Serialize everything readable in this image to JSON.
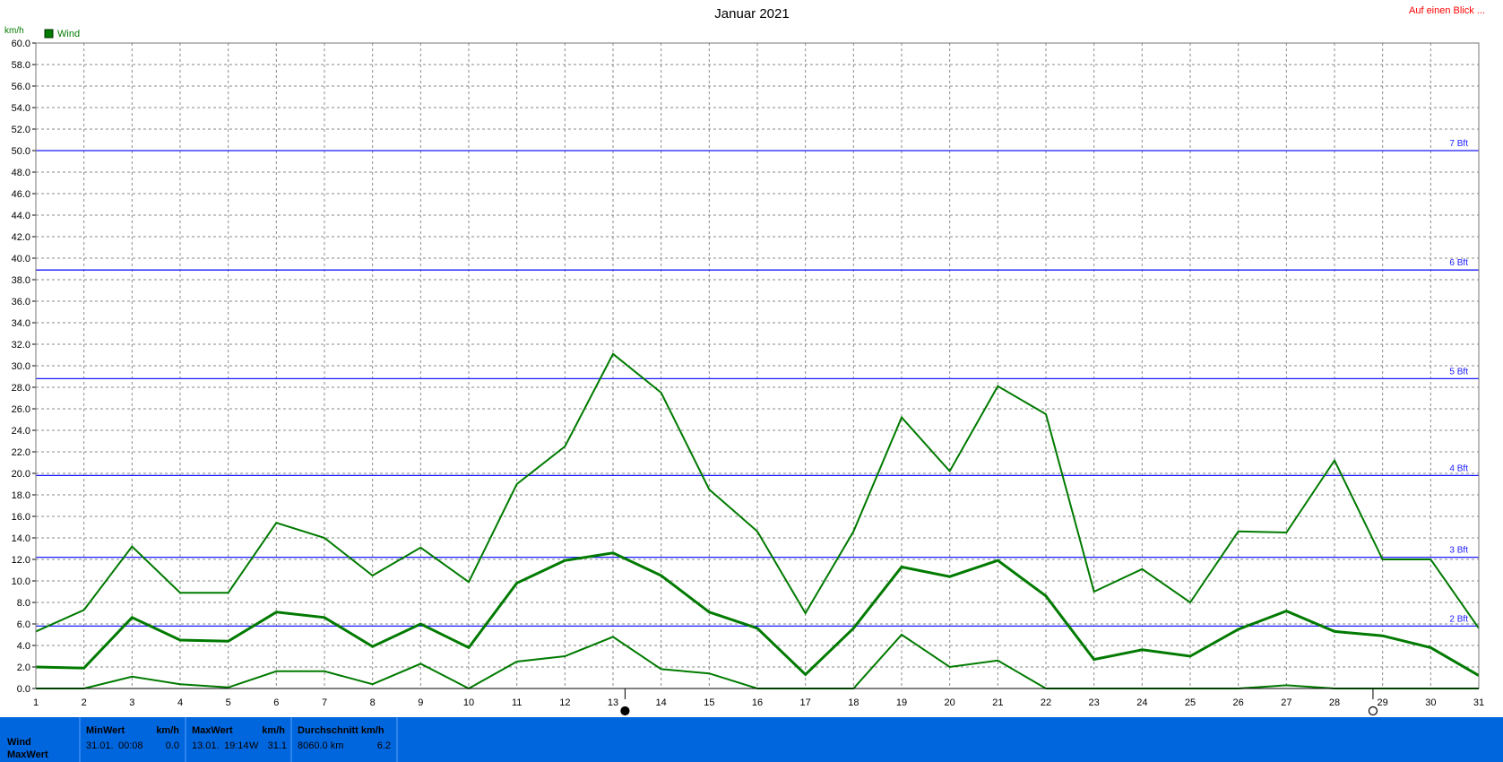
{
  "header": {
    "title": "Januar 2021",
    "top_link": "Auf einen Blick ...",
    "y_unit": "km/h",
    "legend_label": "Wind"
  },
  "colors": {
    "series": "#007a00",
    "beaufort": "#1a1aff",
    "grid": "#8a8a8a",
    "footer_bg": "#0066dd",
    "link": "#ff0000"
  },
  "chart_data": {
    "type": "line",
    "title": "Januar 2021",
    "ylabel": "km/h",
    "xlabel": "",
    "x": [
      1,
      2,
      3,
      4,
      5,
      6,
      7,
      8,
      9,
      10,
      11,
      12,
      13,
      14,
      15,
      16,
      17,
      18,
      19,
      20,
      21,
      22,
      23,
      24,
      25,
      26,
      27,
      28,
      29,
      30,
      31
    ],
    "ylim": [
      0,
      60
    ],
    "xlim": [
      1,
      31
    ],
    "y_tick_step": 2,
    "grid": true,
    "legend": [
      {
        "label": "Wind",
        "position": "top-left"
      }
    ],
    "series": [
      {
        "name": "Wind",
        "role": "max",
        "width": 2,
        "values": [
          5.3,
          7.3,
          13.2,
          8.9,
          8.9,
          15.4,
          14.0,
          10.5,
          13.1,
          9.9,
          19.0,
          22.5,
          31.1,
          27.5,
          18.5,
          14.6,
          7.0,
          14.6,
          25.2,
          20.2,
          28.1,
          25.5,
          9.0,
          11.1,
          8.0,
          14.6,
          14.5,
          21.2,
          12.0,
          12.0,
          5.6
        ]
      },
      {
        "name": "Wind",
        "role": "average",
        "width": 3,
        "values": [
          2.0,
          1.9,
          6.6,
          4.5,
          4.4,
          7.1,
          6.6,
          3.9,
          6.0,
          3.8,
          9.8,
          11.9,
          12.6,
          10.5,
          7.1,
          5.6,
          1.3,
          5.6,
          11.3,
          10.4,
          11.9,
          8.6,
          2.7,
          3.6,
          3.0,
          5.5,
          7.2,
          5.3,
          4.9,
          3.8,
          1.2
        ]
      },
      {
        "name": "Wind",
        "role": "min",
        "width": 2,
        "values": [
          0.0,
          0.0,
          1.1,
          0.4,
          0.1,
          1.6,
          1.6,
          0.4,
          2.3,
          0.0,
          2.5,
          3.0,
          4.8,
          1.8,
          1.4,
          0.0,
          0.0,
          0.0,
          5.0,
          2.0,
          2.6,
          0.0,
          0.0,
          0.0,
          0.0,
          0.0,
          0.3,
          0.0,
          0.0,
          0.0,
          0.0
        ]
      }
    ],
    "reference_lines": [
      {
        "label": "2 Bft",
        "value": 5.8
      },
      {
        "label": "3 Bft",
        "value": 12.2
      },
      {
        "label": "4 Bft",
        "value": 19.8
      },
      {
        "label": "5 Bft",
        "value": 28.8
      },
      {
        "label": "6 Bft",
        "value": 38.9
      },
      {
        "label": "7 Bft",
        "value": 50.0
      }
    ],
    "moon_phases": [
      {
        "day": 13.25,
        "phase": "new-moon"
      },
      {
        "day": 28.8,
        "phase": "full-moon"
      }
    ]
  },
  "footer": {
    "row_labels": [
      "Wind",
      "MaxWert"
    ],
    "min": {
      "header": "MinWert",
      "unit": "km/h",
      "date": "31.01.",
      "time": "00:08",
      "value": "0.0"
    },
    "max": {
      "header": "MaxWert",
      "unit": "km/h",
      "date": "13.01.",
      "time": "19:14",
      "dir": "W",
      "value": "31.1"
    },
    "avg": {
      "header": "Durchschnitt km/h",
      "distance": "8060.0 km",
      "value": "6.2"
    }
  }
}
